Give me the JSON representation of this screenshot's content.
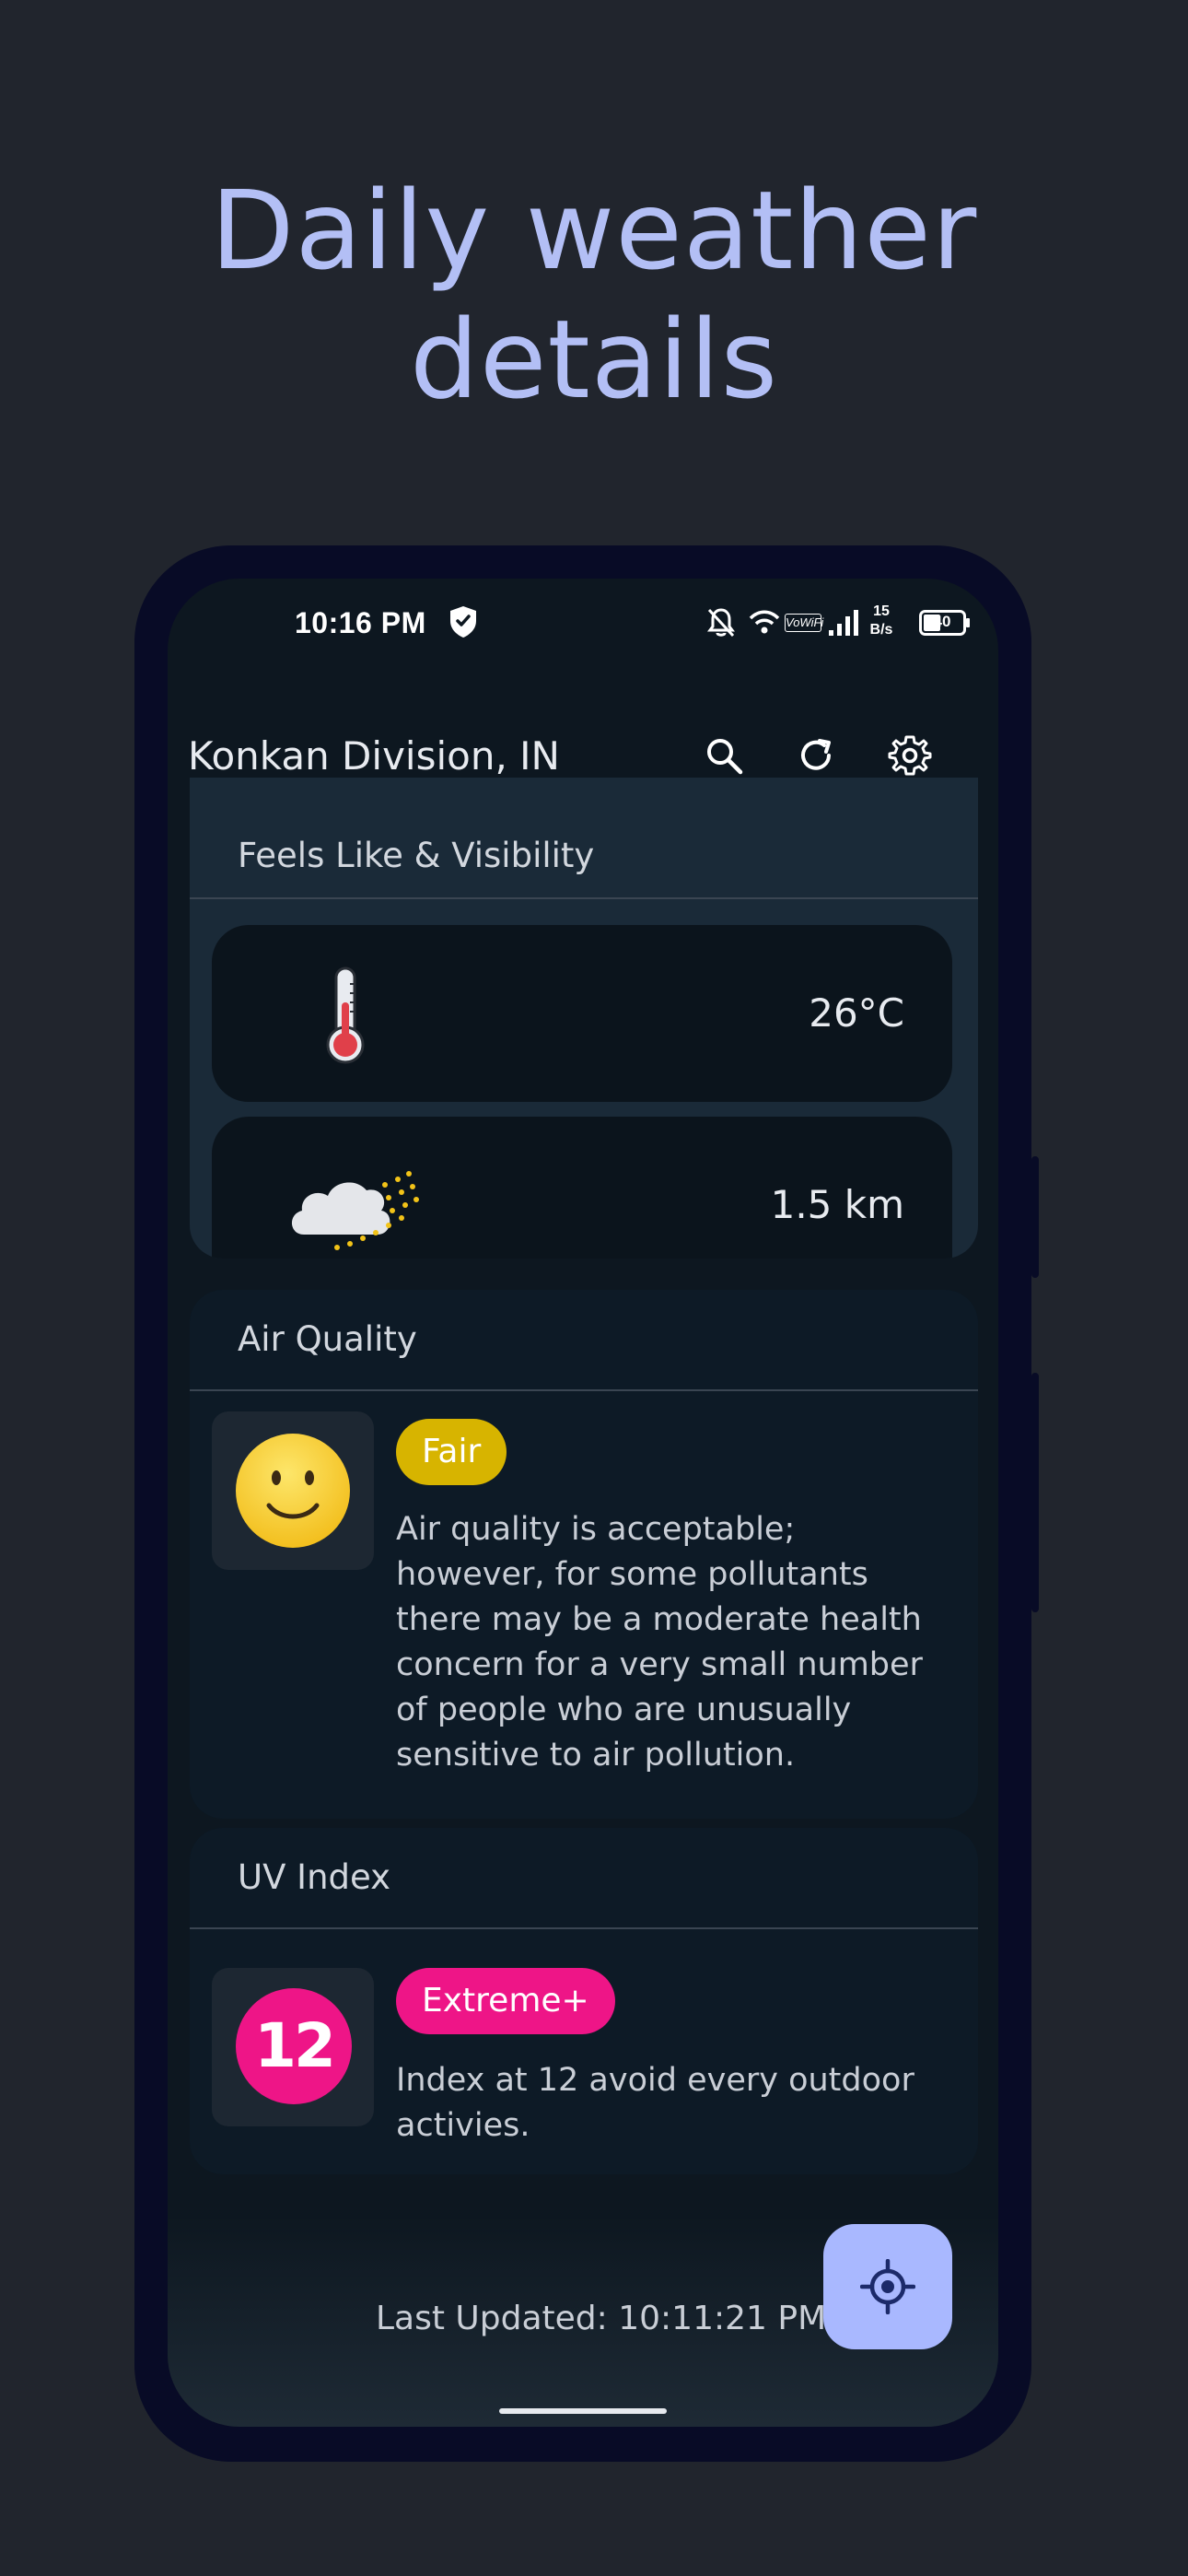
{
  "promo": {
    "title_line1": "Daily weather",
    "title_line2": "details"
  },
  "status_bar": {
    "time": "10:16 PM",
    "net_speed_value": "15",
    "net_speed_unit": "B/s",
    "volte": "VoWiFi",
    "battery": "40"
  },
  "app_bar": {
    "location": "Konkan Division, IN",
    "icons": [
      "search-icon",
      "refresh-icon",
      "settings-icon"
    ]
  },
  "feels_like_card": {
    "title": "Feels Like & Visibility",
    "feels_like_value": "26°C",
    "visibility_value": "1.5 km"
  },
  "air_quality_card": {
    "title": "Air Quality",
    "badge": "Fair",
    "description": "Air quality is acceptable; however, for some pollutants there may be a moderate health concern for a very small number of people who are unusually sensitive to air pollution."
  },
  "uv_card": {
    "title": "UV Index",
    "value": "12",
    "badge": "Extreme+",
    "description": "Index at 12 avoid every outdoor activies."
  },
  "footer": {
    "last_updated": "Last Updated: 10:11:21 PM"
  },
  "colors": {
    "background": "#21252d",
    "promo_text": "#b3bff5",
    "fair_badge": "#d7b400",
    "extreme_badge": "#ee1587",
    "fab": "#a9b8ff"
  }
}
